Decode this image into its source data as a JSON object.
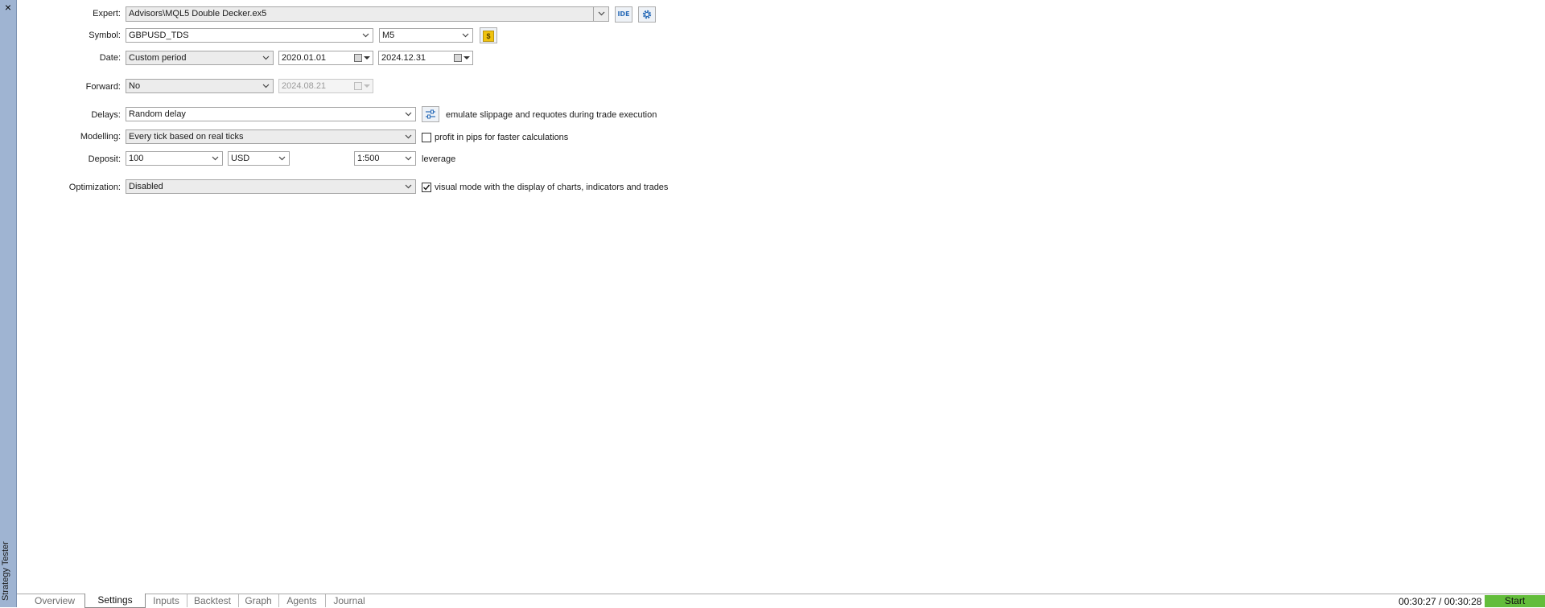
{
  "side": {
    "close_glyph": "×",
    "title": "Strategy Tester"
  },
  "form": {
    "expert": {
      "label": "Expert:",
      "value": "Advisors\\MQL5 Double Decker.ex5",
      "ide_label": "IDE"
    },
    "symbol": {
      "label": "Symbol:",
      "value": "GBPUSD_TDS",
      "timeframe": "M5",
      "money_glyph": "$"
    },
    "date": {
      "label": "Date:",
      "period": "Custom period",
      "from": "2020.01.01",
      "to": "2024.12.31"
    },
    "forward": {
      "label": "Forward:",
      "value": "No",
      "date": "2024.08.21"
    },
    "delays": {
      "label": "Delays:",
      "value": "Random delay",
      "note": "emulate slippage and requotes during trade execution"
    },
    "modelling": {
      "label": "Modelling:",
      "value": "Every tick based on real ticks",
      "checkbox_label": "profit in pips for faster calculations",
      "checked": false
    },
    "deposit": {
      "label": "Deposit:",
      "amount": "100",
      "currency": "USD",
      "leverage": "1:500",
      "leverage_label": "leverage"
    },
    "optimization": {
      "label": "Optimization:",
      "value": "Disabled",
      "checkbox_label": "visual mode with the display of charts, indicators and trades",
      "checked": true
    }
  },
  "tabs": [
    "Overview",
    "Settings",
    "Inputs",
    "Backtest",
    "Graph",
    "Agents",
    "Journal"
  ],
  "active_tab": "Settings",
  "timer": "00:30:27 / 00:30:28",
  "start_label": "Start",
  "colors": {
    "sidebar": "#9fb4d2",
    "start": "#63bd3b",
    "money": "#f0c30f",
    "icon_blue": "#2a6cb8"
  }
}
